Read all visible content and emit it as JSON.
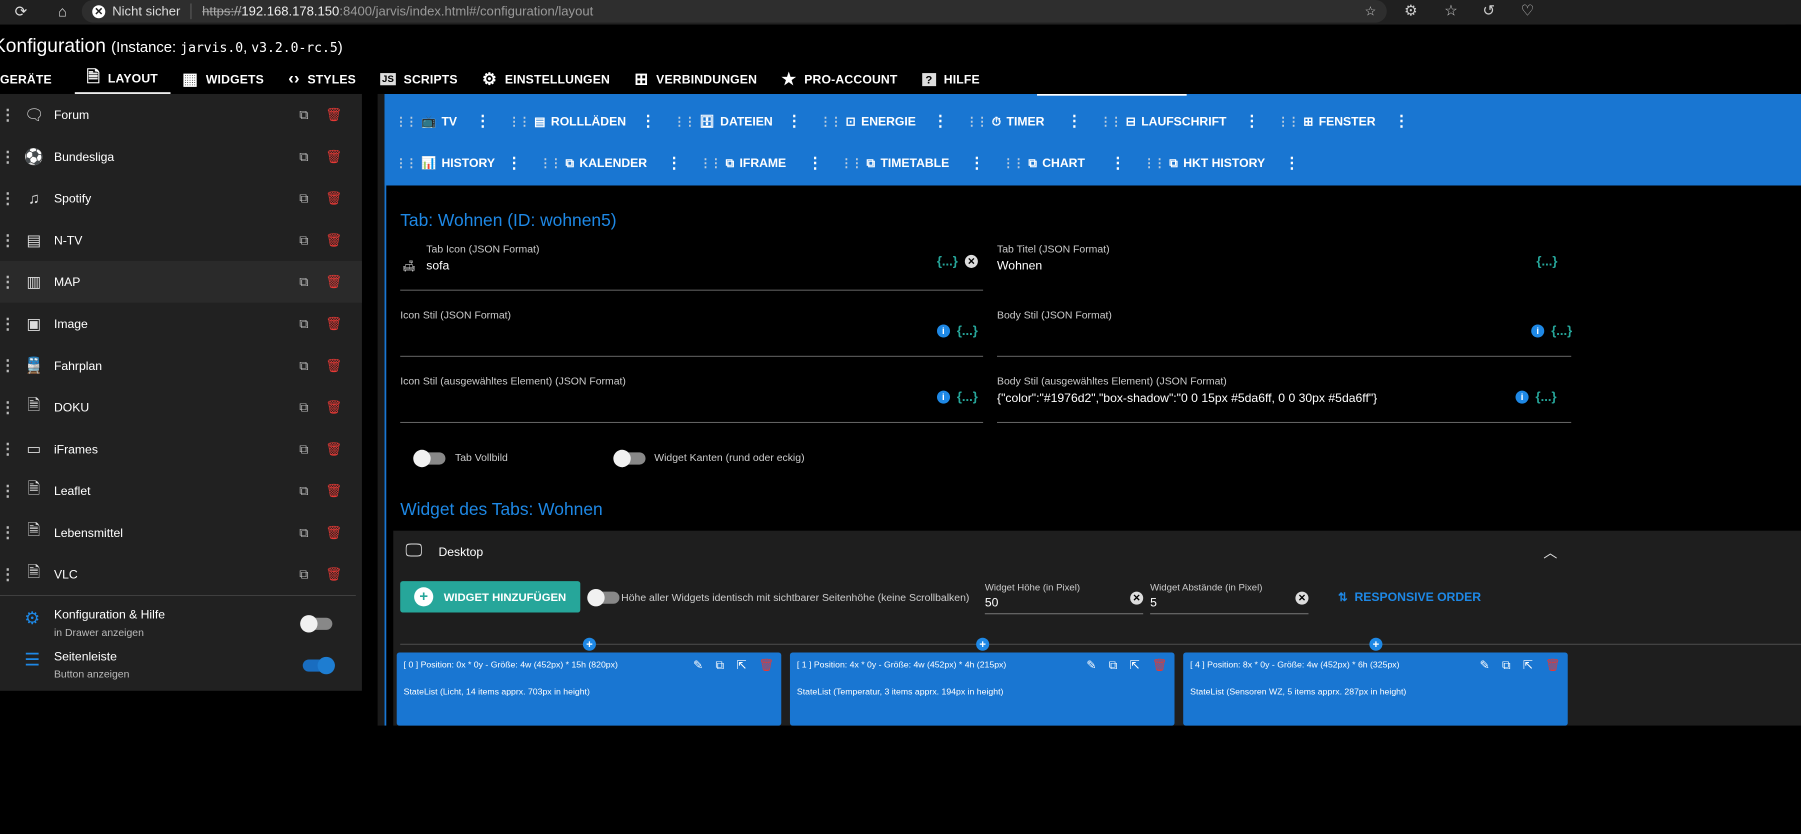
{
  "browser": {
    "security_label": "Nicht sicher",
    "url_scheme": "https://",
    "url_host": "192.168.178.150",
    "url_path": ":8400/jarvis/index.html#/configuration/layout"
  },
  "header": {
    "title": "Konfiguration",
    "instance_prefix": "(Instance: ",
    "instance_mono": "jarvis.0",
    "instance_sep": ", ",
    "version_mono": "v3.2.0-rc.5",
    "instance_suffix": ")"
  },
  "main_tabs": [
    {
      "label": "GERÄTE",
      "icon": "devices-icon"
    },
    {
      "label": "LAYOUT",
      "icon": "file-icon"
    },
    {
      "label": "WIDGETS",
      "icon": "grid-icon"
    },
    {
      "label": "STYLES",
      "icon": "code-icon"
    },
    {
      "label": "SCRIPTS",
      "icon": "js-icon"
    },
    {
      "label": "EINSTELLUNGEN",
      "icon": "gear-icon"
    },
    {
      "label": "VERBINDUNGEN",
      "icon": "network-icon"
    },
    {
      "label": "PRO-ACCOUNT",
      "icon": "star-icon"
    },
    {
      "label": "HILFE",
      "icon": "help-icon"
    }
  ],
  "sidebar": {
    "items": [
      {
        "label": "Forum",
        "icon": "forum-icon"
      },
      {
        "label": "Bundesliga",
        "icon": "soccer-icon"
      },
      {
        "label": "Spotify",
        "icon": "music-icon"
      },
      {
        "label": "N-TV",
        "icon": "news-icon"
      },
      {
        "label": "MAP",
        "icon": "map-icon"
      },
      {
        "label": "Image",
        "icon": "image-icon"
      },
      {
        "label": "Fahrplan",
        "icon": "train-icon"
      },
      {
        "label": "DOKU",
        "icon": "document-icon"
      },
      {
        "label": "iFrames",
        "icon": "window-icon"
      },
      {
        "label": "Leaflet",
        "icon": "document-icon"
      },
      {
        "label": "Lebensmittel",
        "icon": "document-icon"
      },
      {
        "label": "VLC",
        "icon": "document-icon"
      }
    ],
    "options": [
      {
        "title": "Konfiguration & Hilfe",
        "subtitle": "in Drawer anzeigen",
        "icon": "gear-icon",
        "enabled": false
      },
      {
        "title": "Seitenleiste",
        "subtitle": "Button anzeigen",
        "icon": "menu-icon",
        "enabled": true
      }
    ]
  },
  "layout_tabs": {
    "row1": [
      {
        "label": "TV",
        "icon": "tv-icon"
      },
      {
        "label": "ROLLLÄDEN",
        "icon": "blinds-icon"
      },
      {
        "label": "DATEIEN",
        "icon": "file-cabinet-icon"
      },
      {
        "label": "ENERGIE",
        "icon": "energy-icon"
      },
      {
        "label": "TIMER",
        "icon": "timer-icon"
      },
      {
        "label": "LAUFSCHRIFT",
        "icon": "ticker-icon"
      },
      {
        "label": "FENSTER",
        "icon": "window-icon"
      }
    ],
    "row2": [
      {
        "label": "HISTORY",
        "icon": "chart-icon"
      },
      {
        "label": "KALENDER",
        "icon": "tab-icon"
      },
      {
        "label": "IFRAME",
        "icon": "tab-icon"
      },
      {
        "label": "TIMETABLE",
        "icon": "tab-icon"
      },
      {
        "label": "CHART",
        "icon": "tab-icon"
      },
      {
        "label": "HKT HISTORY",
        "icon": "tab-icon"
      }
    ]
  },
  "tab_config": {
    "heading": "Tab: Wohnen (ID: wohnen5)",
    "tab_icon": {
      "label": "Tab Icon (JSON Format)",
      "value": "sofa"
    },
    "tab_title": {
      "label": "Tab Titel (JSON Format)",
      "value": "Wohnen"
    },
    "icon_style": {
      "label": "Icon Stil (JSON Format)",
      "value": ""
    },
    "body_style": {
      "label": "Body Stil (JSON Format)",
      "value": ""
    },
    "icon_style_selected": {
      "label": "Icon Stil (ausgewähltes Element) (JSON Format)",
      "value": ""
    },
    "body_style_selected": {
      "label": "Body Stil (ausgewähltes Element) (JSON Format)",
      "value": "{\"color\":\"#1976d2\",\"box-shadow\":\"0 0 15px #5da6ff,  0 0 30px #5da6ff\"}"
    },
    "json_glyph": "{...}",
    "fullscreen_label": "Tab Vollbild",
    "fullscreen_on": false,
    "edges_label": "Widget Kanten (rund oder eckig)",
    "edges_on": false
  },
  "widgets": {
    "heading": "Widget des Tabs: Wohnen",
    "panel_title": "Desktop",
    "add_label": "WIDGET HINZUFÜGEN",
    "same_height_label": "Höhe aller Widgets identisch mit sichtbarer Seitenhöhe (keine Scrollbalken)",
    "same_height_on": false,
    "height_field": {
      "label": "Widget Höhe (in Pixel)",
      "value": "50"
    },
    "gap_field": {
      "label": "Widget Abstände (in Pixel)",
      "value": "5"
    },
    "responsive_label": "RESPONSIVE ORDER",
    "cards": [
      {
        "title": "[ 0 ] Position: 0x * 0y - Größe: 4w (452px) * 15h (820px)",
        "desc": "StateList (Licht, 14 items apprx. 703px in height)"
      },
      {
        "title": "[ 1 ] Position: 4x * 0y - Größe: 4w (452px) * 4h (215px)",
        "desc": "StateList (Temperatur, 3 items apprx. 194px in height)"
      },
      {
        "title": "[ 4 ] Position: 8x * 0y - Größe: 4w (452px) * 6h (325px)",
        "desc": "StateList (Sensoren WZ, 5 items apprx. 287px in height)"
      }
    ]
  },
  "colors": {
    "accent": "#1976d2",
    "teal": "#26a69a",
    "danger": "#e53935",
    "background": "#000000",
    "sidebar": "#212121"
  }
}
